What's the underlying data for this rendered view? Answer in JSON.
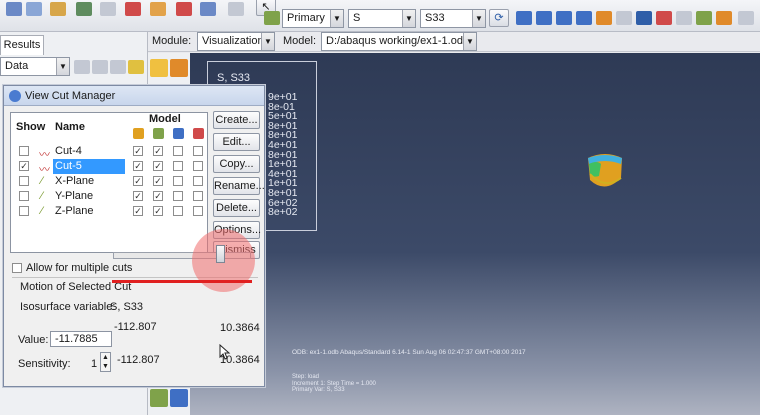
{
  "toolbar": {
    "step_mode": "Primary",
    "variable": "S",
    "component": "S33"
  },
  "module_bar": {
    "module_label": "Module:",
    "module_value": "Visualization",
    "model_label": "Model:",
    "model_value": "D:/abaqus working/ex1-1.odb"
  },
  "left_panel": {
    "tab_label": "Results",
    "tree_combo": "Data"
  },
  "viewport": {
    "legend_title": "S, S33",
    "legend_values": [
      "9e+01",
      "8e-01",
      "5e+01",
      "8e+01",
      "8e+01",
      "4e+01",
      "8e+01",
      "1e+01",
      "4e+01",
      "1e+01",
      "8e+01",
      "6e+02",
      "8e+02"
    ],
    "odb_line": "ODB: ex1-1.odb    Abaqus/Standard 6.14-1    Sun Aug 06 02:47:37 GMT+08:00 2017",
    "step_lines": [
      "Step: load",
      "Increment    1: Step Time =    1.000",
      "Primary Var: S, S33"
    ]
  },
  "dialog": {
    "title": "View Cut Manager",
    "col_show": "Show",
    "col_name": "Name",
    "col_model": "Model",
    "rows": [
      {
        "name": "Cut-4",
        "show": false,
        "icon": "cut-shape-icon",
        "model": [
          true,
          true,
          false,
          false
        ]
      },
      {
        "name": "Cut-5",
        "show": true,
        "icon": "cut-shape-icon",
        "model": [
          true,
          true,
          false,
          false
        ]
      },
      {
        "name": "X-Plane",
        "show": false,
        "icon": "plane-icon",
        "model": [
          true,
          true,
          false,
          false
        ]
      },
      {
        "name": "Y-Plane",
        "show": false,
        "icon": "plane-icon",
        "model": [
          true,
          true,
          false,
          false
        ]
      },
      {
        "name": "Z-Plane",
        "show": false,
        "icon": "plane-icon",
        "model": [
          true,
          true,
          false,
          false
        ]
      }
    ],
    "buttons": [
      "Create...",
      "Edit...",
      "Copy...",
      "Rename...",
      "Delete...",
      "Options...",
      "Dismiss"
    ],
    "allow_multiple": "Allow for multiple cuts",
    "motion_label": "Motion of Selected Cut",
    "iso_label": "Isosurface variable:",
    "iso_value": "S, S33",
    "value_label": "Value:",
    "value": "-11.7885",
    "slider_min": "-112.807",
    "slider_max": "10.3864",
    "sensitivity_label": "Sensitivity:",
    "sensitivity": "1",
    "sens_min": "-112.807",
    "sens_max": "10.3864"
  },
  "colors": {
    "accent": "#3399ff",
    "highlight": "#e02020"
  }
}
